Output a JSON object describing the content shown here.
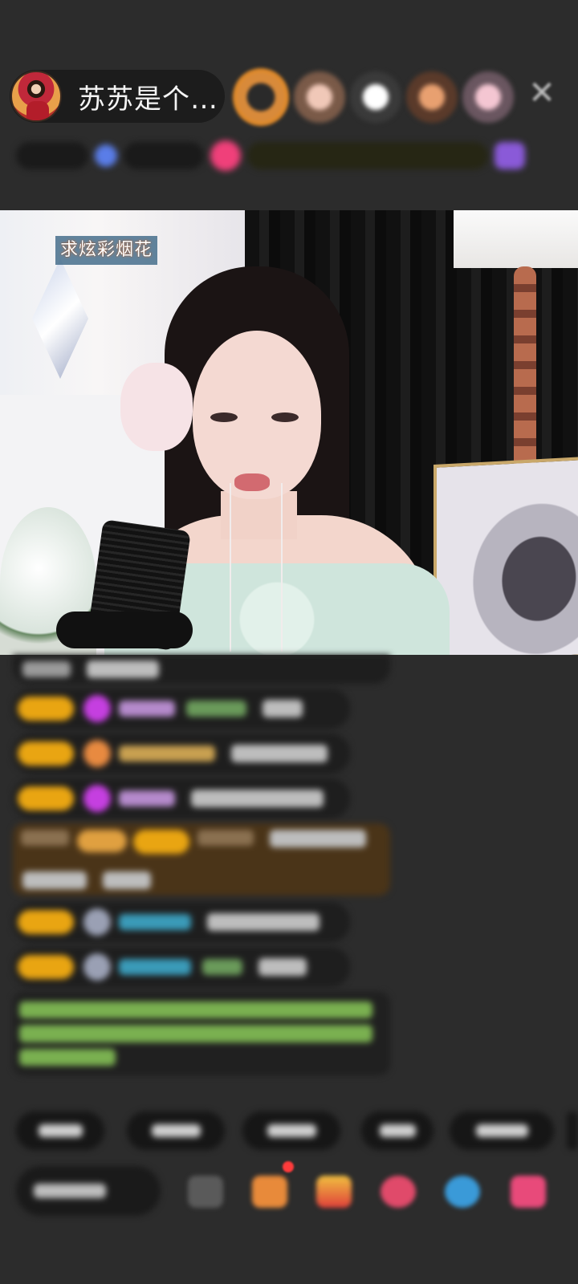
{
  "header": {
    "host_name": "苏苏是个…",
    "host_avatar_icon": "host-avatar",
    "viewer_avatar_count": 5,
    "close_icon": "close-icon",
    "close_glyph": "✕"
  },
  "video": {
    "banner_text": "求炫彩烟花"
  },
  "chat": {
    "message_count": 9
  },
  "colors": {
    "background": "#2c2c2c",
    "level_badge": "#e9a512",
    "gift_message_bg": "#4a3418",
    "notification_dot": "#ff3b3b"
  }
}
